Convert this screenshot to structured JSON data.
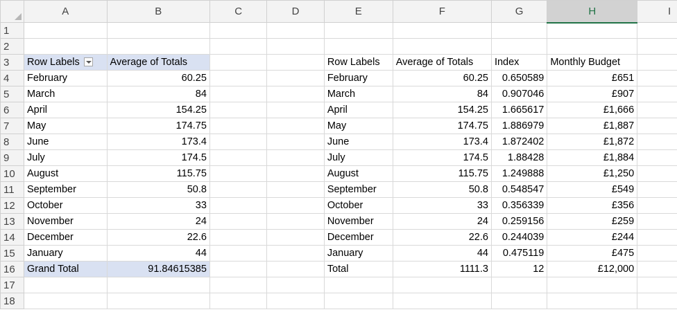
{
  "columns": [
    "A",
    "B",
    "C",
    "D",
    "E",
    "F",
    "G",
    "H",
    "I"
  ],
  "rows": [
    "1",
    "2",
    "3",
    "4",
    "5",
    "6",
    "7",
    "8",
    "9",
    "10",
    "11",
    "12",
    "13",
    "14",
    "15",
    "16",
    "17",
    "18"
  ],
  "pivot": {
    "header_label": "Row Labels",
    "header_value": "Average of Totals",
    "rows": [
      {
        "label": "February",
        "value": "60.25"
      },
      {
        "label": "March",
        "value": "84"
      },
      {
        "label": "April",
        "value": "154.25"
      },
      {
        "label": "May",
        "value": "174.75"
      },
      {
        "label": "June",
        "value": "173.4"
      },
      {
        "label": "July",
        "value": "174.5"
      },
      {
        "label": "August",
        "value": "115.75"
      },
      {
        "label": "September",
        "value": "50.8"
      },
      {
        "label": "October",
        "value": "33"
      },
      {
        "label": "November",
        "value": "24"
      },
      {
        "label": "December",
        "value": "22.6"
      },
      {
        "label": "January",
        "value": "44"
      }
    ],
    "total_label": "Grand Total",
    "total_value": "91.84615385"
  },
  "table": {
    "headers": [
      "Row Labels",
      "Average of Totals",
      "Index",
      "Monthly Budget"
    ],
    "rows": [
      [
        "February",
        "60.25",
        "0.650589",
        "£651"
      ],
      [
        "March",
        "84",
        "0.907046",
        "£907"
      ],
      [
        "April",
        "154.25",
        "1.665617",
        "£1,666"
      ],
      [
        "May",
        "174.75",
        "1.886979",
        "£1,887"
      ],
      [
        "June",
        "173.4",
        "1.872402",
        "£1,872"
      ],
      [
        "July",
        "174.5",
        "1.88428",
        "£1,884"
      ],
      [
        "August",
        "115.75",
        "1.249888",
        "£1,250"
      ],
      [
        "September",
        "50.8",
        "0.548547",
        "£549"
      ],
      [
        "October",
        "33",
        "0.356339",
        "£356"
      ],
      [
        "November",
        "24",
        "0.259156",
        "£259"
      ],
      [
        "December",
        "22.6",
        "0.244039",
        "£244"
      ],
      [
        "January",
        "44",
        "0.475119",
        "£475"
      ]
    ],
    "total": [
      "Total",
      "1111.3",
      "12",
      "£12,000"
    ]
  },
  "colors": {
    "selected_header": "#217346",
    "pivot_fill": "#d9e1f2",
    "gridline": "#d9d9d9"
  },
  "icons": {
    "corner": "select-all-triangle",
    "filter": "filter-dropdown-icon"
  }
}
